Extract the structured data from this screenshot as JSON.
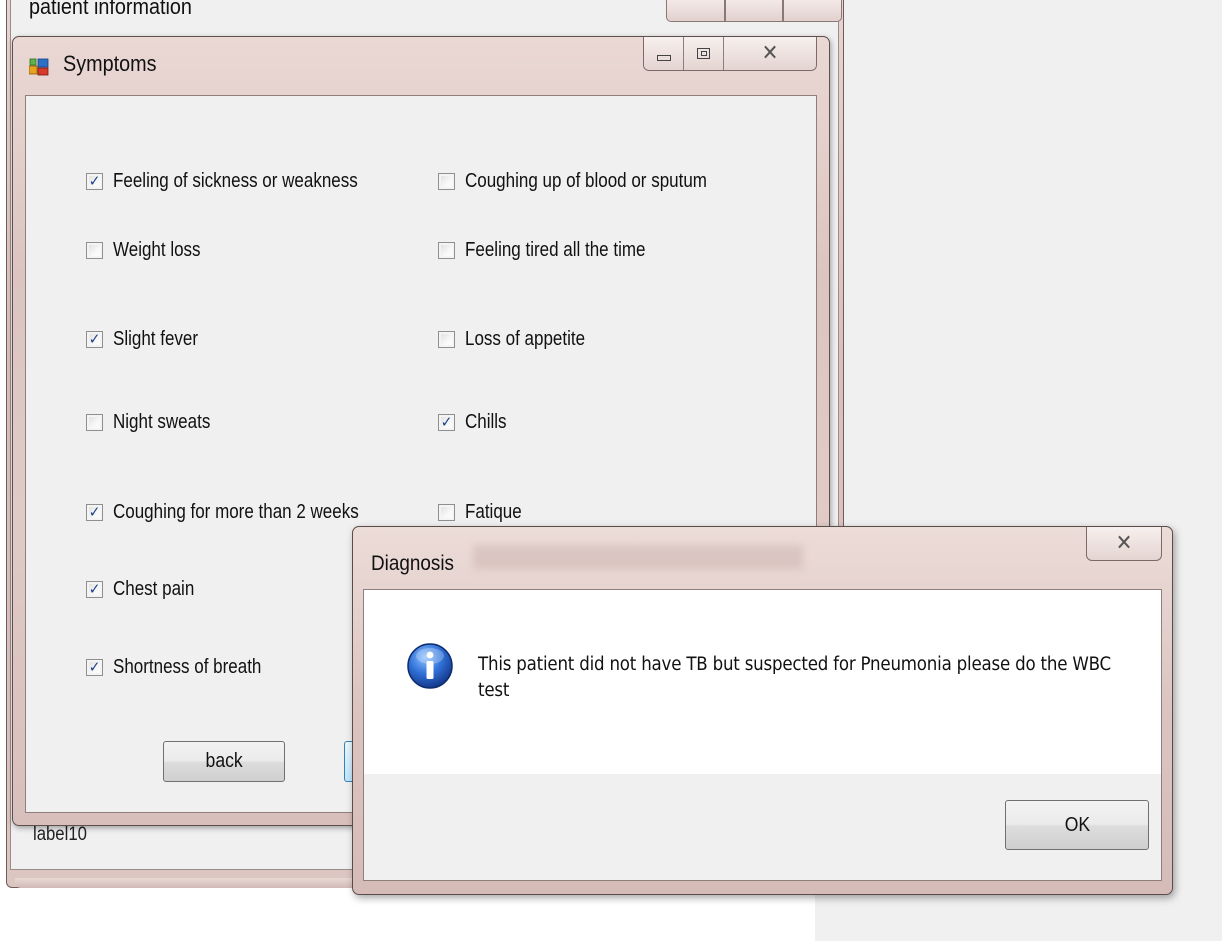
{
  "background_window": {
    "title": "patient information",
    "label10": "label10"
  },
  "symptoms_window": {
    "title": "Symptoms",
    "checkboxes": [
      {
        "label": "Feeling of sickness or weakness",
        "checked": true
      },
      {
        "label": "Coughing up of blood or sputum",
        "checked": false
      },
      {
        "label": "Weight loss",
        "checked": false
      },
      {
        "label": "Feeling tired all the time",
        "checked": false
      },
      {
        "label": "Slight fever",
        "checked": true
      },
      {
        "label": "Loss of appetite",
        "checked": false
      },
      {
        "label": "Night sweats",
        "checked": false
      },
      {
        "label": "Chills",
        "checked": true
      },
      {
        "label": "Coughing for more than 2 weeks",
        "checked": true
      },
      {
        "label": "Fatique",
        "checked": false
      },
      {
        "label": "Chest pain",
        "checked": true
      },
      {
        "label": "Shortness of breath",
        "checked": true
      }
    ],
    "back_label": "back"
  },
  "dialog": {
    "title": "Diagnosis",
    "message": "This patient did not have TB but suspected for Pneumonia please do the WBC test",
    "ok_label": "OK",
    "icon": "info-icon"
  },
  "colors": {
    "check_mark": "#1c3f8c",
    "window_frame": "#dcc5c1",
    "client_bg": "#f0f0f0"
  }
}
